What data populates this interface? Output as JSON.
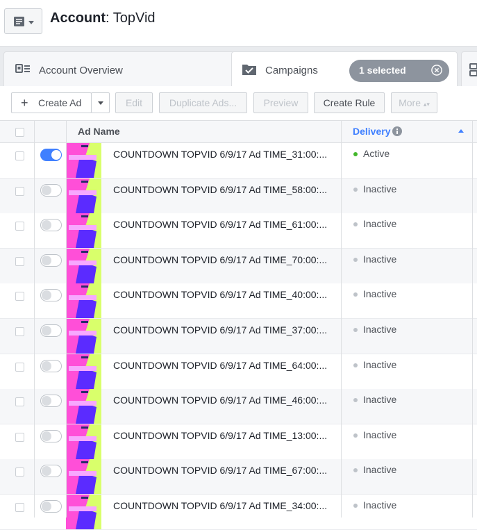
{
  "header": {
    "account_label": "Account",
    "account_name": "TopVid"
  },
  "tabs": {
    "overview": "Account Overview",
    "campaigns": "Campaigns",
    "selected": "1 selected"
  },
  "toolbar": {
    "create_ad": "Create Ad",
    "edit": "Edit",
    "duplicate": "Duplicate Ads...",
    "preview": "Preview",
    "create_rule": "Create Rule",
    "more": "More"
  },
  "table": {
    "col_ad_name": "Ad Name",
    "col_delivery": "Delivery",
    "rows": [
      {
        "name": "COUNTDOWN TOPVID 6/9/17 Ad TIME_31:00:...",
        "status": "Active"
      },
      {
        "name": "COUNTDOWN TOPVID 6/9/17 Ad TIME_58:00:...",
        "status": "Inactive"
      },
      {
        "name": "COUNTDOWN TOPVID 6/9/17 Ad TIME_61:00:...",
        "status": "Inactive"
      },
      {
        "name": "COUNTDOWN TOPVID 6/9/17 Ad TIME_70:00:...",
        "status": "Inactive"
      },
      {
        "name": "COUNTDOWN TOPVID 6/9/17 Ad TIME_40:00:...",
        "status": "Inactive"
      },
      {
        "name": "COUNTDOWN TOPVID 6/9/17 Ad TIME_37:00:...",
        "status": "Inactive"
      },
      {
        "name": "COUNTDOWN TOPVID 6/9/17 Ad TIME_64:00:...",
        "status": "Inactive"
      },
      {
        "name": "COUNTDOWN TOPVID 6/9/17 Ad TIME_46:00:...",
        "status": "Inactive"
      },
      {
        "name": "COUNTDOWN TOPVID 6/9/17 Ad TIME_13:00:...",
        "status": "Inactive"
      },
      {
        "name": "COUNTDOWN TOPVID 6/9/17 Ad TIME_67:00:...",
        "status": "Inactive"
      },
      {
        "name": "COUNTDOWN TOPVID 6/9/17 Ad TIME_34:00:...",
        "status": "Inactive"
      }
    ]
  },
  "colors": {
    "accent": "#4080ff",
    "active_dot": "#42b72a",
    "inactive_dot": "#bec3c9"
  }
}
